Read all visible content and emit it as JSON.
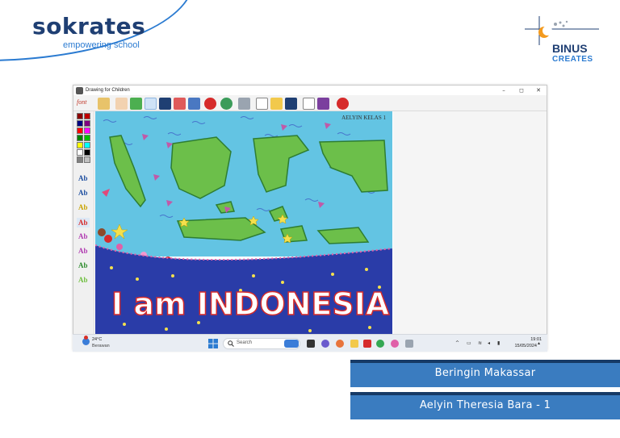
{
  "branding": {
    "sokrates_name": "sokrates",
    "sokrates_tagline": "empowering school",
    "binus_name": "BINUS",
    "binus_sub": "CREATES"
  },
  "window": {
    "title": "Drawing for Children",
    "controls": {
      "minimize": "–",
      "maximize": "◻",
      "close": "✕"
    }
  },
  "toolbar": {
    "font_label": "font",
    "buttons": [
      "paint-bucket",
      "hand",
      "brush",
      "text",
      "stamp",
      "frame",
      "picture",
      "burst",
      "globe",
      "printer",
      "new-file",
      "open-folder",
      "save",
      "edit",
      "book",
      "stop"
    ]
  },
  "palette": {
    "colors": [
      "#8b0000",
      "#c00000",
      "#000080",
      "#800080",
      "#ff0000",
      "#ff00ff",
      "#008000",
      "#00c000",
      "#ffff00",
      "#00ffff",
      "#ffffff",
      "#000000",
      "#808080",
      "#c0c0c0"
    ]
  },
  "text_styles": [
    {
      "label": "Ab",
      "color": "#1f4fa0"
    },
    {
      "label": "Ab",
      "color": "#1f4fa0"
    },
    {
      "label": "Ab",
      "color": "#c9a300"
    },
    {
      "label": "Ab",
      "color": "#d62b2b"
    },
    {
      "label": "Ab",
      "color": "#b03ab0"
    },
    {
      "label": "Ab",
      "color": "#b03ab0"
    },
    {
      "label": "Ab",
      "color": "#2e8b2e"
    },
    {
      "label": "Ab",
      "color": "#6fbf3f"
    }
  ],
  "canvas": {
    "corner_text": "AELYIN KELAS 1",
    "main_text": "I am INDONESIA",
    "colors": {
      "sea": "#63c4e3",
      "land": "#6cbf4a",
      "night": "#2a3ca8",
      "text": "#ffffff",
      "text_stroke": "#d62b2b"
    }
  },
  "taskbar": {
    "temperature": "24°C",
    "condition": "Berawan",
    "search_placeholder": "Search",
    "time": "19:01",
    "date": "15/05/2024"
  },
  "banners": {
    "school": "Beringin Makassar",
    "student": "Aelyin Theresia Bara - 1"
  }
}
